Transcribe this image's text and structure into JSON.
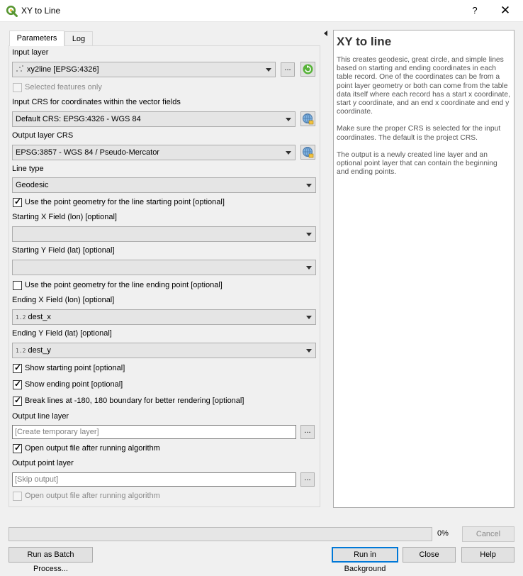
{
  "window": {
    "title": "XY to Line",
    "help_symbol": "?",
    "close_symbol": "✕"
  },
  "tabs": [
    {
      "label": "Parameters",
      "active": true
    },
    {
      "label": "Log",
      "active": false
    }
  ],
  "params": {
    "input_layer_label": "Input layer",
    "input_layer_value": "xy2line [EPSG:4326]",
    "input_layer_browse": "...",
    "selected_only_label": "Selected features only",
    "input_crs_label": "Input CRS for coordinates within the vector fields",
    "input_crs_value": "Default CRS: EPSG:4326 - WGS 84",
    "output_crs_label": "Output layer CRS",
    "output_crs_value": "EPSG:3857 - WGS 84 / Pseudo-Mercator",
    "line_type_label": "Line type",
    "line_type_value": "Geodesic",
    "use_start_geom_label": "Use the point geometry for the line starting point [optional]",
    "start_x_label": "Starting X Field (lon) [optional]",
    "start_x_value": "",
    "start_y_label": "Starting Y Field (lat) [optional]",
    "start_y_value": "",
    "use_end_geom_label": "Use the point geometry for the line ending point [optional]",
    "end_x_label": "Ending X Field (lon) [optional]",
    "end_x_type": "1.2",
    "end_x_value": "dest_x",
    "end_y_label": "Ending Y Field (lat) [optional]",
    "end_y_type": "1.2",
    "end_y_value": "dest_y",
    "show_start_label": "Show starting point [optional]",
    "show_end_label": "Show ending point [optional]",
    "break_lines_label": "Break lines at -180, 180 boundary for better rendering [optional]",
    "output_line_label": "Output line layer",
    "output_line_placeholder": "[Create temporary layer]",
    "output_line_browse": "...",
    "open_line_label": "Open output file after running algorithm",
    "output_point_label": "Output point layer",
    "output_point_placeholder": "[Skip output]",
    "output_point_browse": "...",
    "open_point_label": "Open output file after running algorithm"
  },
  "help": {
    "title": "XY to line",
    "paragraphs": [
      "This creates geodesic, great circle, and simple lines based on starting and ending coordinates in each table record. One of the coordinates can be from a point layer geometry or both can come from the table data itself where each record has a start x coordinate, start y coordinate, and an end x coordinate and end y coordinate.",
      "Make sure the proper CRS is selected for the input coordinates. The default is the project CRS.",
      "The output is a newly created line layer and an optional point layer that can contain the beginning and ending points."
    ]
  },
  "footer": {
    "progress_percent": 0,
    "progress_text": "0%",
    "cancel_label": "Cancel",
    "batch_label": "Run as Batch Process...",
    "run_bg_label": "Run in Background",
    "close_label": "Close",
    "help_label": "Help"
  },
  "checkbox_states": {
    "selected_only": false,
    "use_start_geom": true,
    "use_end_geom": false,
    "show_start": true,
    "show_end": true,
    "break_lines": true,
    "open_line": true,
    "open_point": false
  },
  "colors": {
    "qgis_green": "#589632",
    "accent_blue": "#0078d7"
  }
}
